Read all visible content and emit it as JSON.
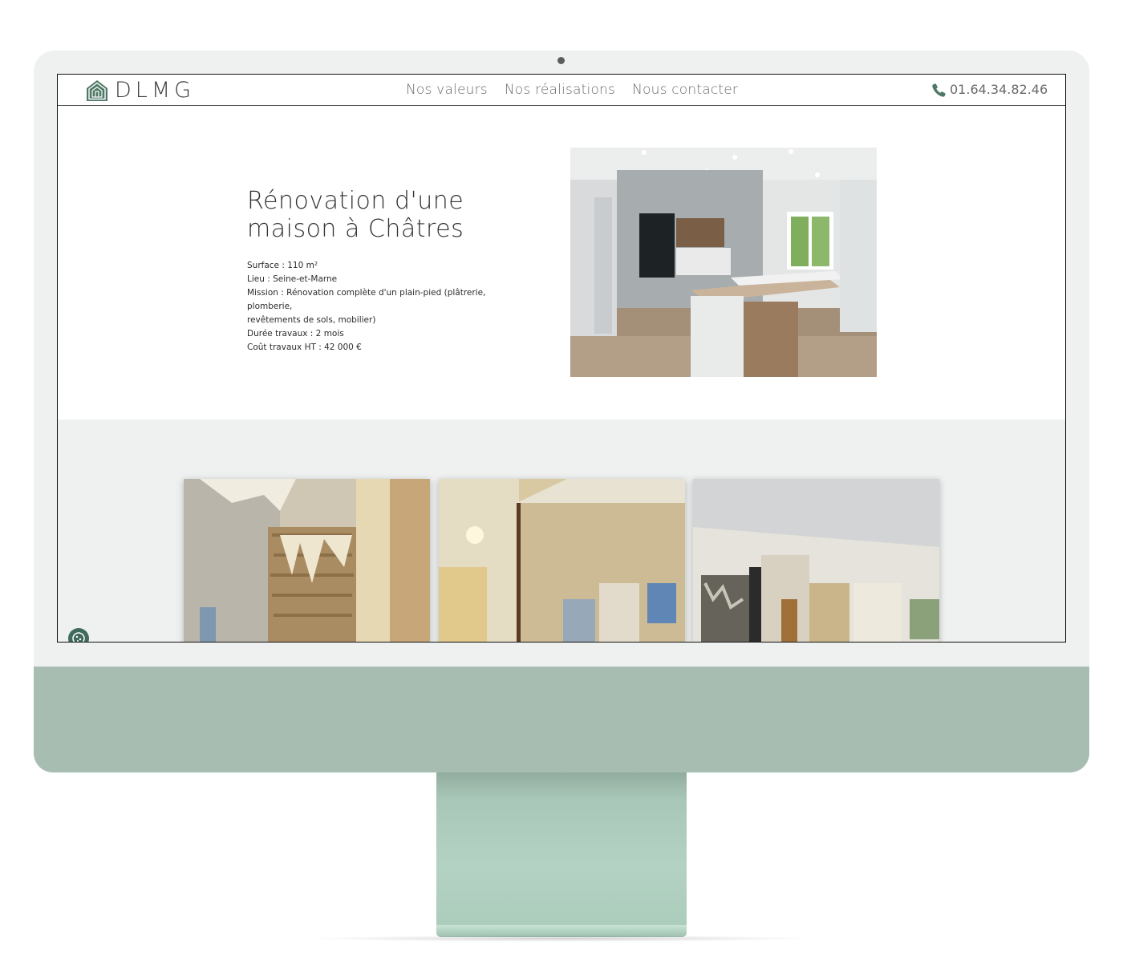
{
  "brand": {
    "name": "DLMG",
    "accent": "#4f7866"
  },
  "nav": {
    "items": [
      {
        "label": "Nos valeurs"
      },
      {
        "label": "Nos réalisations"
      },
      {
        "label": "Nous contacter"
      }
    ]
  },
  "contact": {
    "phone": "01.64.34.82.46",
    "icon": "phone-icon"
  },
  "project": {
    "title_line1": "Rénovation d'une",
    "title_line2": "maison à Châtres",
    "details": [
      "Surface : 110 m²",
      "Lieu : Seine-et-Marne",
      "Mission : Rénovation complète d'un plain-pied (plâtrerie, plomberie,",
      "revêtements de sols, mobilier)",
      "Durée travaux : 2 mois",
      "Coût travaux HT : 42 000 €"
    ]
  },
  "cookie_button": {
    "icon": "cookie-icon"
  }
}
